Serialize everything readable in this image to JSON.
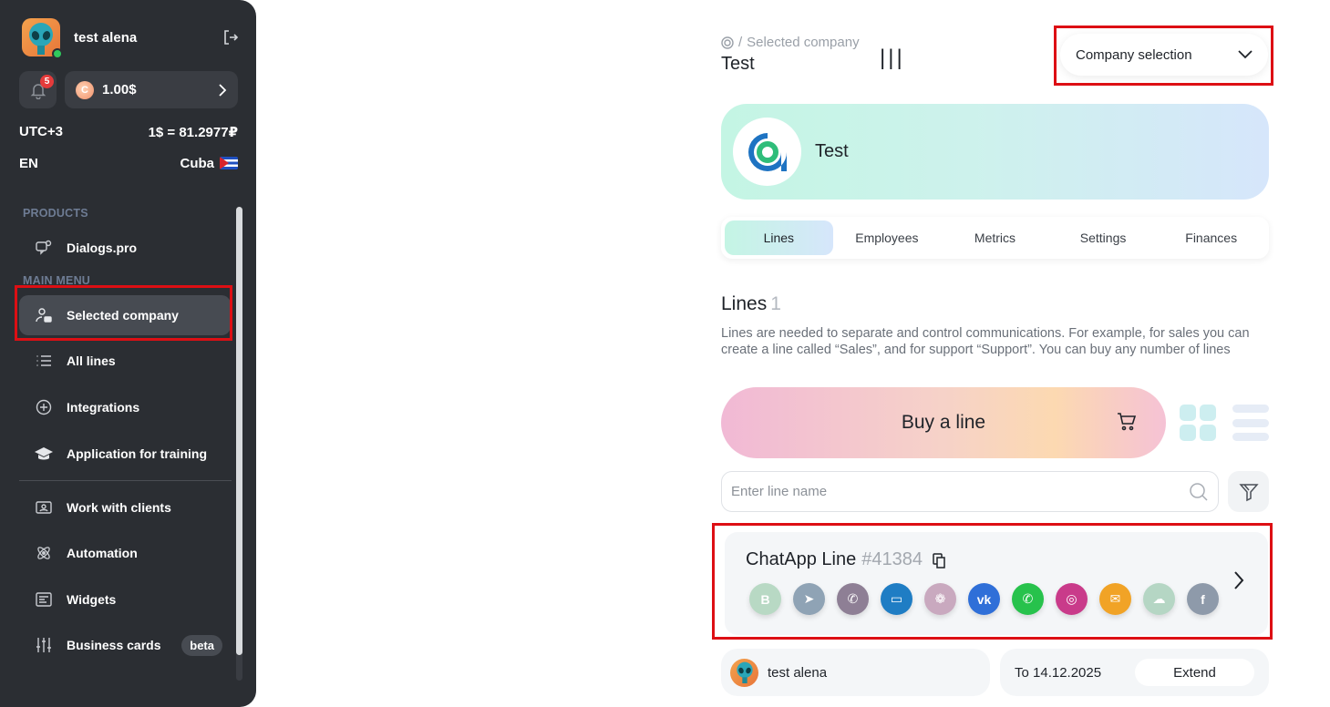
{
  "user": {
    "name": "test alena",
    "status": "online"
  },
  "notifications": {
    "count": "5"
  },
  "balance": {
    "coin_symbol": "C",
    "value": "1.00$"
  },
  "meta": {
    "timezone": "UTC+3",
    "rate": "1$ = 81.2977₽",
    "language": "EN",
    "country": "Cuba"
  },
  "sidebar": {
    "products_label": "PRODUCTS",
    "products": [
      {
        "label": "Dialogs.pro",
        "icon": "dialogs-icon"
      }
    ],
    "main_menu_label": "MAIN MENU",
    "main_items": [
      {
        "label": "Selected company",
        "icon": "company-user-icon",
        "active": true
      },
      {
        "label": "All lines",
        "icon": "list-icon"
      },
      {
        "label": "Integrations",
        "icon": "plus-circle-icon"
      },
      {
        "label": "Application for training",
        "icon": "graduation-cap-icon"
      }
    ],
    "extra_items": [
      {
        "label": "Work with clients",
        "icon": "contact-card-icon"
      },
      {
        "label": "Automation",
        "icon": "atom-icon"
      },
      {
        "label": "Widgets",
        "icon": "widget-icon"
      },
      {
        "label": "Business cards",
        "icon": "sliders-icon",
        "badge": "beta"
      }
    ]
  },
  "header": {
    "breadcrumb_sep": "/",
    "breadcrumb_current": "Selected company",
    "title": "Test",
    "cursor_text": "|||",
    "company_select_label": "Company selection"
  },
  "company": {
    "name": "Test"
  },
  "tabs": [
    {
      "label": "Lines",
      "active": true
    },
    {
      "label": "Employees"
    },
    {
      "label": "Metrics"
    },
    {
      "label": "Settings"
    },
    {
      "label": "Finances"
    }
  ],
  "lines": {
    "heading": "Lines",
    "count": "1",
    "description": "Lines are needed to separate and control communications. For example, for sales you can create a line called “Sales”, and for support “Support”. You can buy any number of lines",
    "buy_label": "Buy a line",
    "search_placeholder": "Enter line name"
  },
  "line_card": {
    "name": "ChatApp Line",
    "number": "#41384",
    "channels": [
      {
        "name": "whatsapp-business",
        "letter": "B",
        "color": "#b8d9c4"
      },
      {
        "name": "telegram",
        "letter": "➤",
        "color": "#8fa3b5"
      },
      {
        "name": "viber",
        "letter": "✆",
        "color": "#8e7f95"
      },
      {
        "name": "chat-bot",
        "letter": "▭",
        "color": "#1f7dc4"
      },
      {
        "name": "dialogs",
        "letter": "❁",
        "color": "#c9a9bf"
      },
      {
        "name": "vk",
        "letter": "vk",
        "color": "#2f6fd8"
      },
      {
        "name": "whatsapp",
        "letter": "✆",
        "color": "#27c24c"
      },
      {
        "name": "instagram",
        "letter": "◎",
        "color": "#c93b8a"
      },
      {
        "name": "email",
        "letter": "✉",
        "color": "#f1a326"
      },
      {
        "name": "chat-widget",
        "letter": "☁",
        "color": "#b5d6c4"
      },
      {
        "name": "facebook",
        "letter": "f",
        "color": "#8e9aaa"
      }
    ]
  },
  "footer": {
    "owner_name": "test alena",
    "valid_to": "To 14.12.2025",
    "extend_label": "Extend"
  },
  "colors": {
    "sidebar_bg": "#2b2e33",
    "highlight_red": "#dd0f14",
    "accent_mint": "#c4f5e4",
    "accent_blue": "#d6e6fb"
  }
}
